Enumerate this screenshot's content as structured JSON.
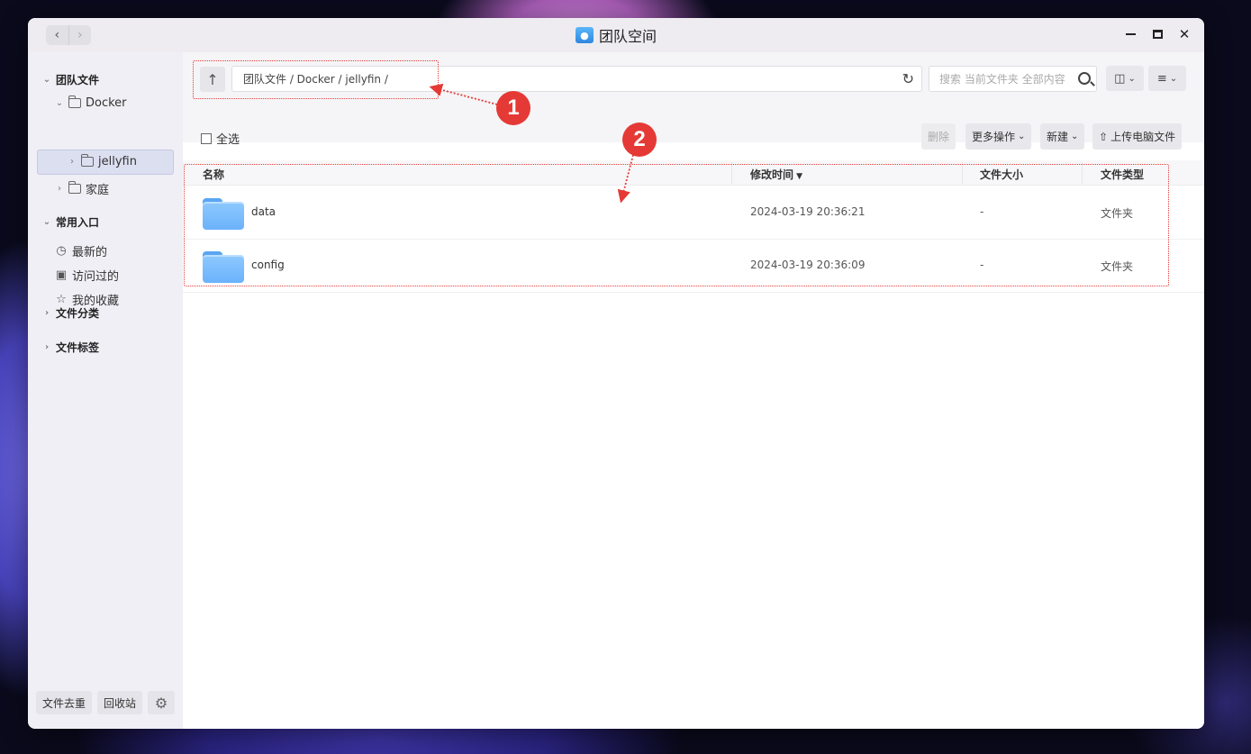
{
  "window": {
    "title": "团队空间",
    "back_arrow": "‹",
    "forward_arrow": "›"
  },
  "sidebar": {
    "team_files": "团队文件",
    "docker": "Docker",
    "jellyfin": "jellyfin",
    "family": "家庭",
    "common": "常用入口",
    "recent": "最新的",
    "visited": "访问过的",
    "favorites": "我的收藏",
    "file_category": "文件分类",
    "file_tags": "文件标签",
    "dedupe_button": "文件去重",
    "recycle_button": "回收站"
  },
  "toolbar": {
    "path": "团队文件 / Docker / jellyfin /",
    "search_placeholder": "搜索 当前文件夹 全部内容",
    "select_all": "全选",
    "delete": "删除",
    "more_actions": "更多操作",
    "new": "新建",
    "upload": "上传电脑文件"
  },
  "table": {
    "headers": [
      "名称",
      "修改时间",
      "文件大小",
      "文件类型"
    ],
    "rows": [
      {
        "name": "data",
        "modified": "2024-03-19 20:36:21",
        "size": "-",
        "type": "文件夹"
      },
      {
        "name": "config",
        "modified": "2024-03-19 20:36:09",
        "size": "-",
        "type": "文件夹"
      }
    ]
  },
  "annotations": {
    "badge_1": "1",
    "badge_2": "2",
    "color": "#e53935"
  },
  "icons": {
    "up": "arrow-up-icon",
    "refresh": "refresh-icon",
    "search": "search-icon",
    "gear": "gear-icon",
    "folder": "folder-icon"
  }
}
